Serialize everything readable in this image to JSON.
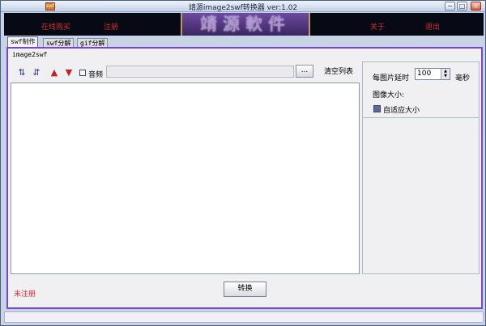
{
  "window": {
    "title": "靖源image2swf转换器 ver:1.02",
    "app_icon_text": "swf"
  },
  "window_controls": {
    "minimize": "−",
    "maximize": "□",
    "close": "×"
  },
  "banner": {
    "logo_text": "靖源軟件",
    "menu": {
      "buy_online": "在线购买",
      "register": "注册",
      "about": "关于",
      "exit": "退出"
    }
  },
  "tabs": [
    "swf制作",
    "swf分解",
    "gif分解"
  ],
  "panel": {
    "caption": "image2swf",
    "toolbar": {
      "audio_label": "音频",
      "browse_label": "...",
      "clear_list_label": "清空列表"
    },
    "settings": {
      "delay_label": "每图片延时",
      "delay_value": "100",
      "delay_unit": "毫秒",
      "size_label": "图像大小:",
      "autosize_label": "自适应大小"
    }
  },
  "footer": {
    "unregistered_label": "未注册",
    "convert_label": "转换"
  },
  "colors": {
    "accent": "#7a45c8",
    "warning_text": "#d72b2b",
    "banner_bg": "#070a14"
  },
  "icons": [
    "sort-ascending-icon",
    "sort-descending-icon",
    "arrow-up-icon",
    "arrow-down-icon"
  ]
}
